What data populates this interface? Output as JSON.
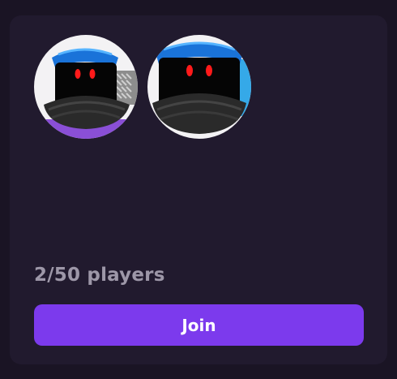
{
  "server": {
    "players_text": "2/50 players",
    "join_label": "Join"
  },
  "avatars": [
    {
      "name": "player-avatar-1"
    },
    {
      "name": "player-avatar-2"
    }
  ],
  "colors": {
    "page_bg": "#1a1424",
    "card_bg": "#211a2e",
    "accent": "#7c3aed",
    "muted_text": "#9d97a8"
  }
}
